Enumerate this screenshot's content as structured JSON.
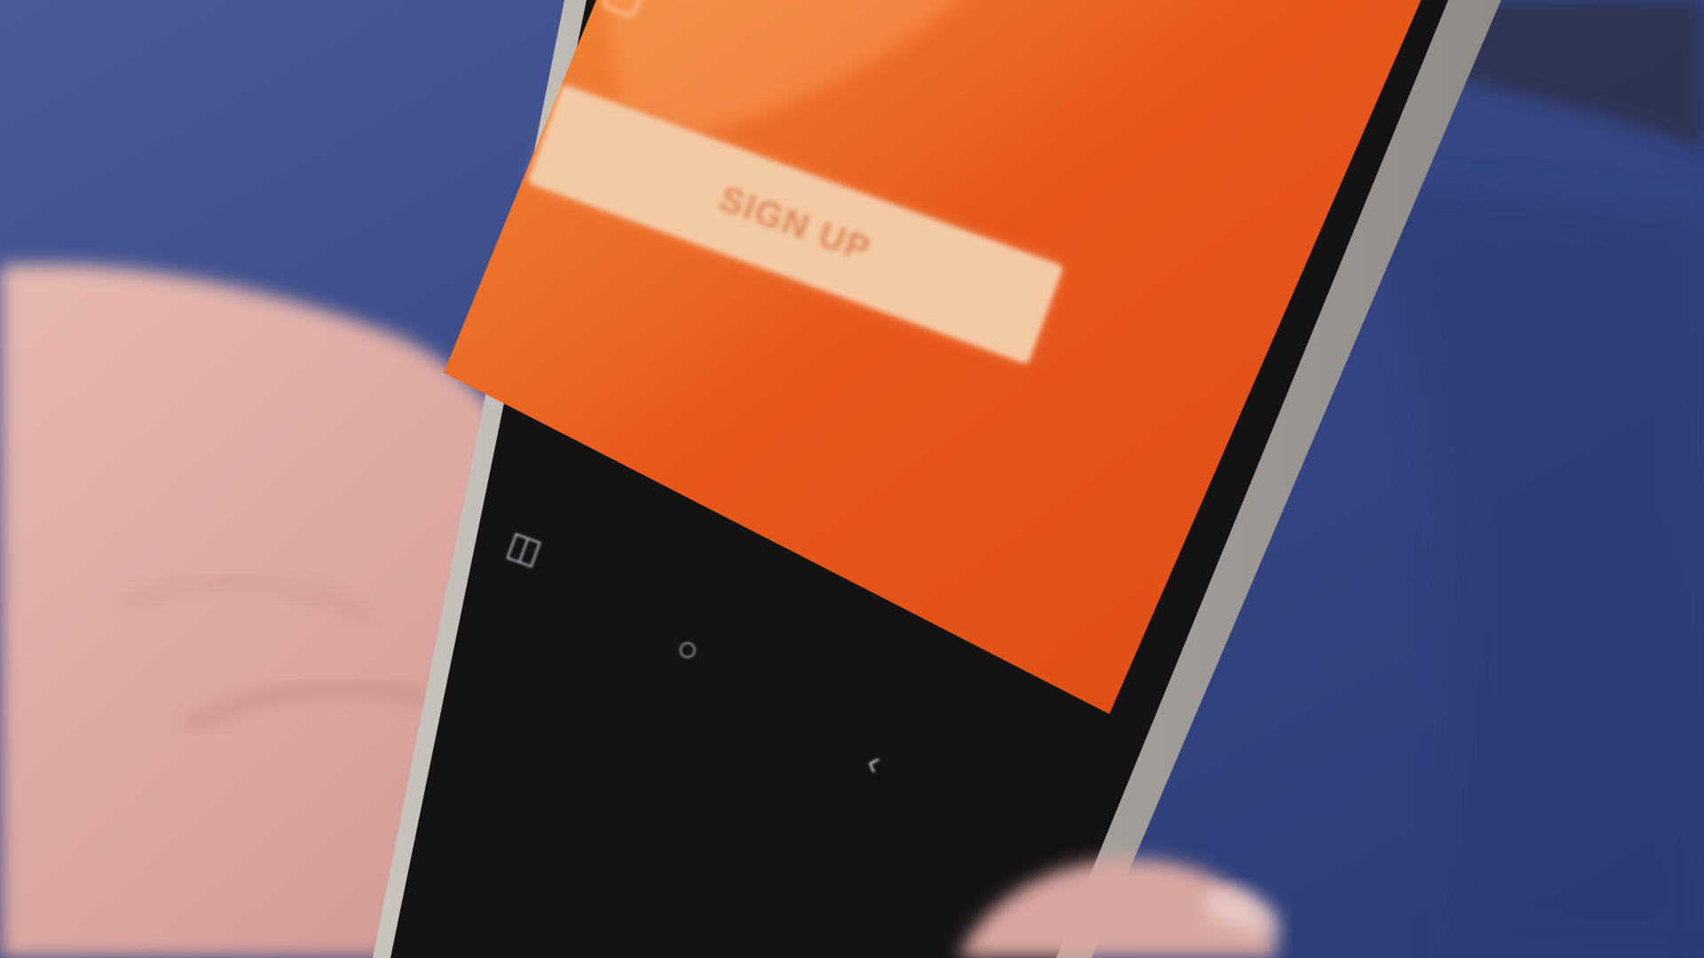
{
  "screen": {
    "remember_label": "",
    "forgot_link": "",
    "side_link": "",
    "bottom_link": "",
    "signup_button_label": "SIGN UP",
    "background_color": "#e8571a",
    "button_color": "#f3c9a4"
  },
  "navbar": {
    "recent_icon": "recent-apps-icon",
    "home_icon": "home-icon",
    "back_icon": "back-icon",
    "recent_glyph": "◫",
    "home_glyph": "○",
    "back_glyph": "‹"
  }
}
